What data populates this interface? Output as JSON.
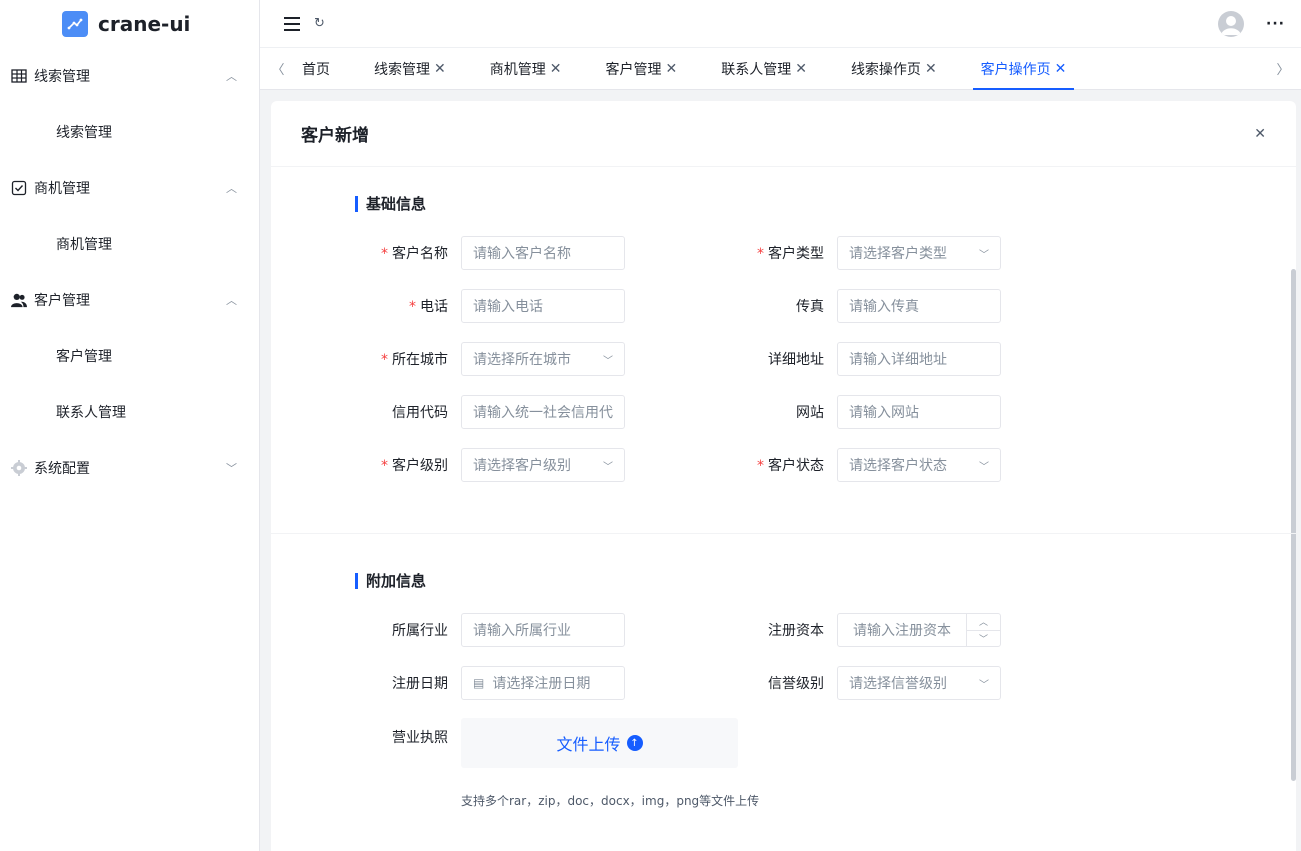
{
  "app": {
    "name": "crane-ui"
  },
  "sidebar": {
    "groups": [
      {
        "label": "线索管理",
        "icon": "table-icon",
        "expanded": true,
        "items": [
          "线索管理"
        ]
      },
      {
        "label": "商机管理",
        "icon": "checkbox-icon",
        "expanded": true,
        "items": [
          "商机管理"
        ]
      },
      {
        "label": "客户管理",
        "icon": "users-icon",
        "expanded": true,
        "items": [
          "客户管理",
          "联系人管理"
        ]
      },
      {
        "label": "系统配置",
        "icon": "gear-icon",
        "expanded": false,
        "items": []
      }
    ]
  },
  "tabs": [
    {
      "label": "首页",
      "closable": false,
      "active": false
    },
    {
      "label": "线索管理",
      "closable": true,
      "active": false
    },
    {
      "label": "商机管理",
      "closable": true,
      "active": false
    },
    {
      "label": "客户管理",
      "closable": true,
      "active": false
    },
    {
      "label": "联系人管理",
      "closable": true,
      "active": false
    },
    {
      "label": "线索操作页",
      "closable": true,
      "active": false
    },
    {
      "label": "客户操作页",
      "closable": true,
      "active": true
    }
  ],
  "form": {
    "title": "客户新增",
    "basic": {
      "title": "基础信息",
      "fields": {
        "name": {
          "label": "客户名称",
          "placeholder": "请输入客户名称",
          "required": true
        },
        "type": {
          "label": "客户类型",
          "placeholder": "请选择客户类型",
          "required": true
        },
        "phone": {
          "label": "电话",
          "placeholder": "请输入电话",
          "required": true
        },
        "fax": {
          "label": "传真",
          "placeholder": "请输入传真",
          "required": false
        },
        "city": {
          "label": "所在城市",
          "placeholder": "请选择所在城市",
          "required": true
        },
        "address": {
          "label": "详细地址",
          "placeholder": "请输入详细地址",
          "required": false
        },
        "credit_code": {
          "label": "信用代码",
          "placeholder": "请输入统一社会信用代码",
          "required": false
        },
        "website": {
          "label": "网站",
          "placeholder": "请输入网站",
          "required": false
        },
        "level": {
          "label": "客户级别",
          "placeholder": "请选择客户级别",
          "required": true
        },
        "status": {
          "label": "客户状态",
          "placeholder": "请选择客户状态",
          "required": true
        }
      }
    },
    "extra": {
      "title": "附加信息",
      "fields": {
        "industry": {
          "label": "所属行业",
          "placeholder": "请输入所属行业"
        },
        "capital": {
          "label": "注册资本",
          "placeholder": "请输入注册资本"
        },
        "reg_date": {
          "label": "注册日期",
          "placeholder": "请选择注册日期"
        },
        "reputation": {
          "label": "信誉级别",
          "placeholder": "请选择信誉级别"
        },
        "license": {
          "label": "营业执照"
        }
      },
      "upload": {
        "label": "文件上传",
        "hint": "支持多个rar，zip，doc，docx，img，png等文件上传"
      }
    }
  },
  "colors": {
    "primary": "#165dff",
    "required": "#f53f3f",
    "logo": "#4c8df6"
  }
}
